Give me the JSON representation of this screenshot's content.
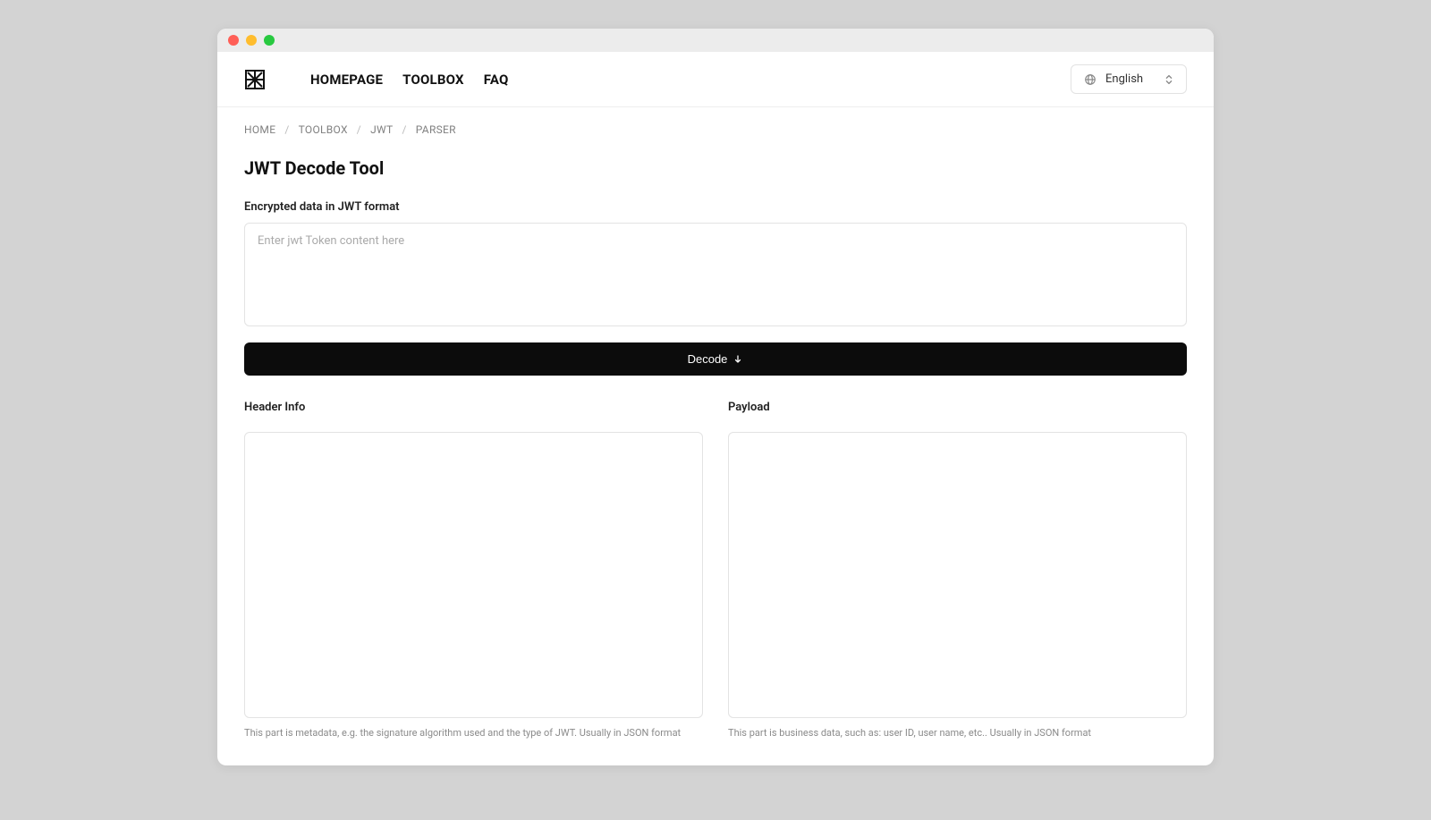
{
  "nav": {
    "items": [
      "HOMEPAGE",
      "TOOLBOX",
      "FAQ"
    ]
  },
  "language": {
    "selected": "English"
  },
  "breadcrumb": {
    "items": [
      "HOME",
      "TOOLBOX",
      "JWT",
      "PARSER"
    ]
  },
  "page": {
    "title": "JWT Decode Tool"
  },
  "input": {
    "label": "Encrypted data in JWT format",
    "placeholder": "Enter jwt Token content here",
    "value": ""
  },
  "decode": {
    "label": "Decode"
  },
  "output": {
    "header": {
      "label": "Header Info",
      "value": "",
      "hint": "This part is metadata, e.g. the signature algorithm used and the type of JWT. Usually in JSON format"
    },
    "payload": {
      "label": "Payload",
      "value": "",
      "hint": "This part is business data, such as: user ID, user name, etc.. Usually in JSON format"
    }
  }
}
